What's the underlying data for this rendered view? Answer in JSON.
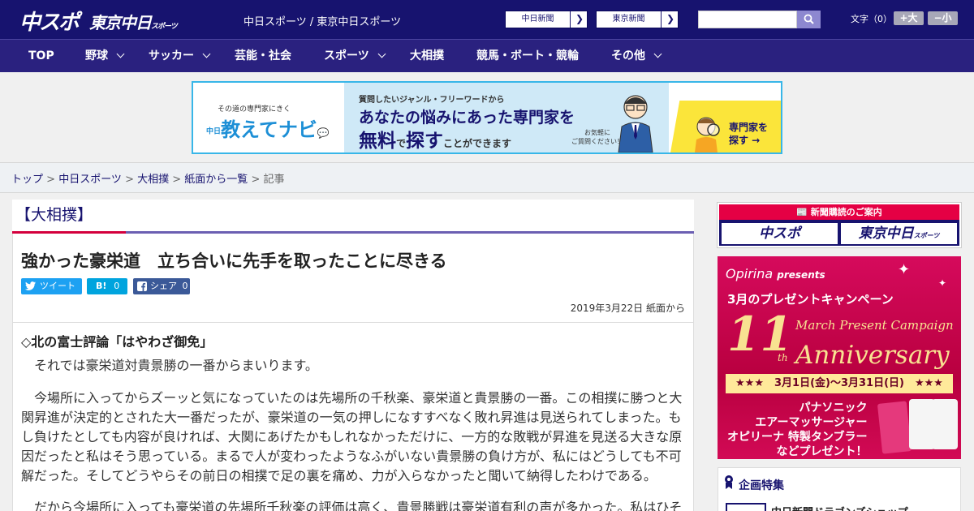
{
  "header": {
    "logo_main": "中スポ",
    "logo_tokyo": "東京中日",
    "logo_tokyo_sub": "スポーツ",
    "site_links": "中日スポーツ / 東京中日スポーツ",
    "btn_chunichi": "中日新聞",
    "btn_tokyo": "東京新聞",
    "search_placeholder": "",
    "font_label": "文字（0）",
    "font_large": "+大",
    "font_small": "−小"
  },
  "nav": {
    "items": [
      {
        "label": "TOP"
      },
      {
        "label": "野球"
      },
      {
        "label": "サッカー"
      },
      {
        "label": "芸能・社会"
      },
      {
        "label": "スポーツ"
      },
      {
        "label": "大相撲"
      },
      {
        "label": "競馬・ボート・競輪"
      },
      {
        "label": "その他"
      }
    ]
  },
  "banner": {
    "small": "その道の専門家にきく",
    "brand": "教えてナビ",
    "brand_prefix": "中日",
    "line1": "質問したいジャンル・フリーワードから",
    "line2": "あなたの悩みにあった専門家を",
    "line3_a": "無料",
    "line3_b": "で",
    "line3_c": "探す",
    "line3_d": "ことができます",
    "otoki1": "お気軽に",
    "otoki2": "ご質問ください！",
    "cta1": "専門家を",
    "cta2": "探す →"
  },
  "breadcrumb": {
    "items": [
      "トップ",
      "中日スポーツ",
      "大相撲",
      "紙面から一覧"
    ],
    "current": "記事",
    "sep": " > "
  },
  "article": {
    "category": "【大相撲】",
    "title": "強かった豪栄道　立ち合いに先手を取ったことに尽きる",
    "tweet": "ツイート",
    "hatena_count": "0",
    "share_label": "シェア",
    "share_count": "0",
    "date": "2019年3月22日 紙面から",
    "subtitle": "◇北の富士評論「はやわざ御免」",
    "p1": "　それでは豪栄道対貴景勝の一番からまいります。",
    "p2": "　今場所に入ってからズーッと気になっていたのは先場所の千秋楽、豪栄道と貴景勝の一番。この相撲に勝つと大関昇進が決定的とされた大一番だったが、豪栄道の一気の押しになすすべなく敗れ昇進は見送られてしまった。もし負けたとしても内容が良ければ、大関にあげたかもしれなかっただけに、一方的な敗戦が昇進を見送る大きな原因だったと私はそう思っている。まるで人が変わったようなふがいない貴景勝の負け方が、私にはどうしても不可解だった。そしてどうやらその前日の相撲で足の裏を痛め、力が入らなかったと聞いて納得したわけである。",
    "p3": "　だから今場所に入っても豪栄道の先場所千秋楽の評価は高く、貴景勝戦は豪栄道有利の声が多かった。私はひそ"
  },
  "sidebar": {
    "subscribe_head": "新聞購読のご案内",
    "subscribe_a": "中スポ",
    "subscribe_b": "東京中日",
    "subscribe_b_sub": "スポーツ",
    "promo_brand": "Opirina",
    "promo_presents": "presents",
    "promo_campaign": "3月のプレゼントキャンペーン",
    "promo_num": "11",
    "promo_th": "th",
    "promo_mpc": "March Present Campaign",
    "promo_anniv": "Anniversary",
    "promo_date": "★★★　3月1日(金)〜3月31日(日)　★★★",
    "promo_prod1": "パナソニック",
    "promo_prod2": "エアーマッサージャー",
    "promo_prod3": "オピリーナ 特製タンブラー",
    "promo_prod4": "などプレゼント！",
    "features_title": "企画特集",
    "features_item": "中日新聞ドラゴンズショップ"
  }
}
